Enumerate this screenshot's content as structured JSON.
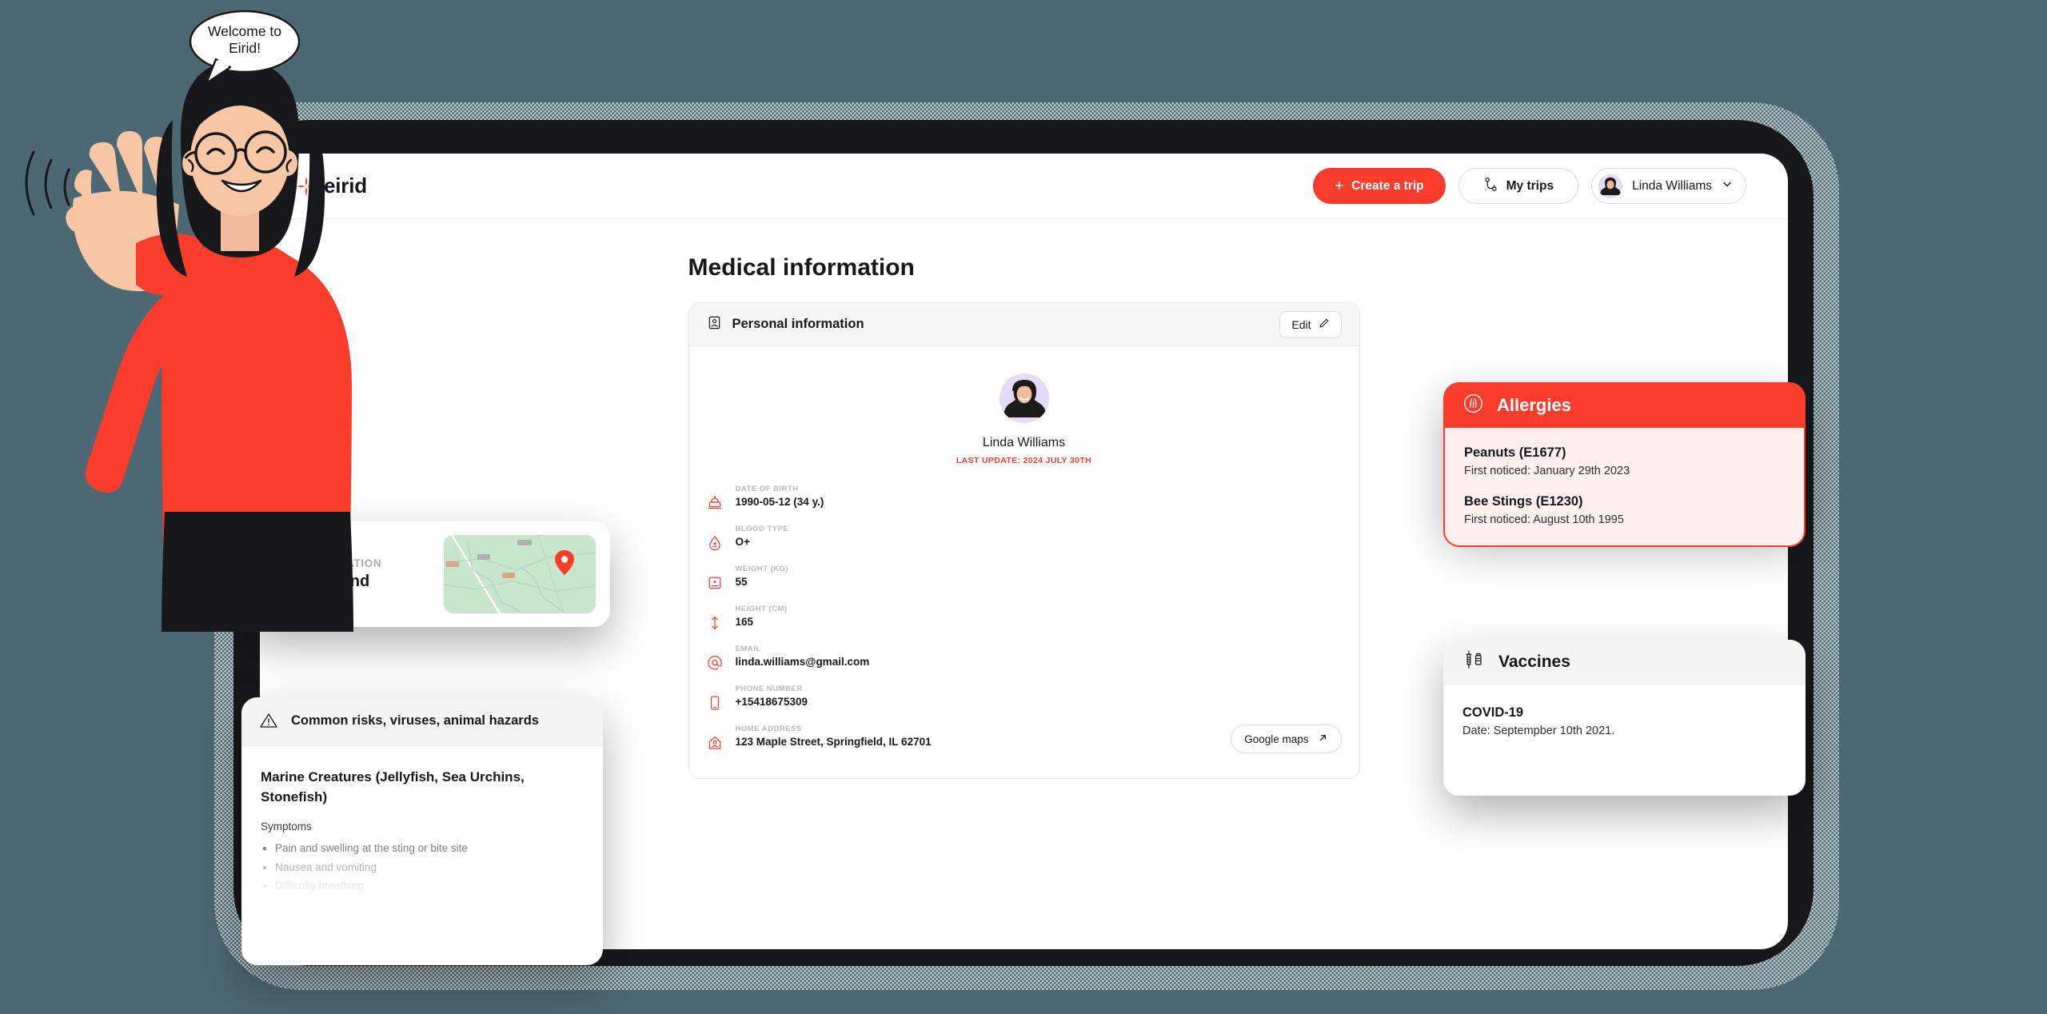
{
  "topbar": {
    "logo_text": "eirid",
    "create_trip_label": "Create a trip",
    "my_trips_label": "My trips",
    "user_name": "Linda Williams"
  },
  "page": {
    "title": "Medical information"
  },
  "personal_card": {
    "header_title": "Personal information",
    "edit_label": "Edit",
    "profile_name": "Linda Williams",
    "last_update": "LAST UPDATE: 2024 JULY 30TH",
    "maps_label": "Google maps",
    "fields": [
      {
        "label": "DATE OF BIRTH",
        "value": "1990-05-12 (34 y.)",
        "icon": "cake-icon"
      },
      {
        "label": "BLOOD TYPE",
        "value": "O+",
        "icon": "blood-drop-icon"
      },
      {
        "label": "WEIGHT (KG)",
        "value": "55",
        "icon": "scale-icon"
      },
      {
        "label": "HEIGHT (CM)",
        "value": "165",
        "icon": "height-arrow-icon"
      },
      {
        "label": "EMAIL",
        "value": "linda.williams@gmail.com",
        "icon": "at-icon"
      },
      {
        "label": "PHONE NUMBER",
        "value": "+15418675309",
        "icon": "phone-icon"
      },
      {
        "label": "HOME ADDRESS",
        "value": "123 Maple Street, Springfield, IL 62701",
        "icon": "home-icon"
      }
    ]
  },
  "destination_card": {
    "label": "DESTINATION",
    "value": "Thailand"
  },
  "risks_card": {
    "title": "Common risks, viruses, animal hazards",
    "risk_name": "Marine Creatures (Jellyfish, Sea Urchins, Stonefish)",
    "symptoms_heading": "Symptoms",
    "symptoms": [
      "Pain and swelling at the sting or bite site",
      "Nausea and vomiting",
      "Difficulty breathing"
    ]
  },
  "allergies_card": {
    "title": "Allergies",
    "items": [
      {
        "name": "Peanuts (E1677)",
        "detail": "First noticed: January 29th 2023"
      },
      {
        "name": "Bee Stings (E1230)",
        "detail": "First noticed: August 10th 1995"
      }
    ]
  },
  "vaccines_card": {
    "title": "Vaccines",
    "items": [
      {
        "name": "COVID-19",
        "detail": "Date: Septempber 10th 2021."
      }
    ]
  },
  "mascot": {
    "speech_text": "Welcome to Eirid!"
  },
  "colors": {
    "background": "#4c6872",
    "brand_red": "#fa3c2d",
    "allergy_bg": "#fdf0ef",
    "card_head": "#f4f4f4",
    "text": "#17181a",
    "muted": "#b9b9b9"
  }
}
